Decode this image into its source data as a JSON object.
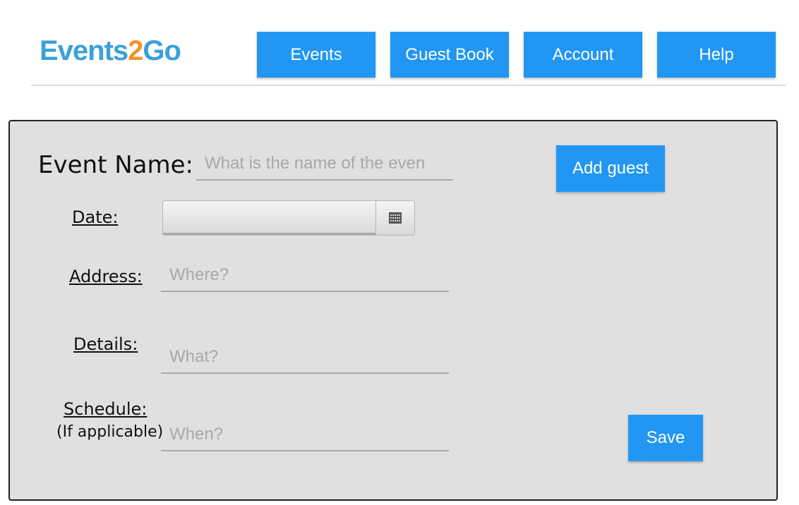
{
  "header": {
    "logo": {
      "prefix": "Events",
      "digit": "2",
      "suffix": "Go"
    },
    "nav": [
      {
        "label": "Events"
      },
      {
        "label": "Guest Book"
      },
      {
        "label": "Account"
      },
      {
        "label": "Help"
      }
    ],
    "colors": {
      "accent": "#2196f3",
      "logo_blue": "#3aa0dc",
      "logo_orange": "#f5912b",
      "panel_bg": "#e0e0e0"
    }
  },
  "form": {
    "event_name": {
      "label": "Event Name:",
      "placeholder": "What is the name of the even"
    },
    "date": {
      "label": "Date:",
      "value": "",
      "icon": "calendar-icon"
    },
    "address": {
      "label": "Address:",
      "placeholder": "Where?"
    },
    "details": {
      "label": "Details:",
      "placeholder": "What?"
    },
    "schedule": {
      "label": "Schedule:",
      "note": "(If applicable)",
      "placeholder": "When?"
    },
    "add_guest_label": "Add guest",
    "save_label": "Save"
  }
}
